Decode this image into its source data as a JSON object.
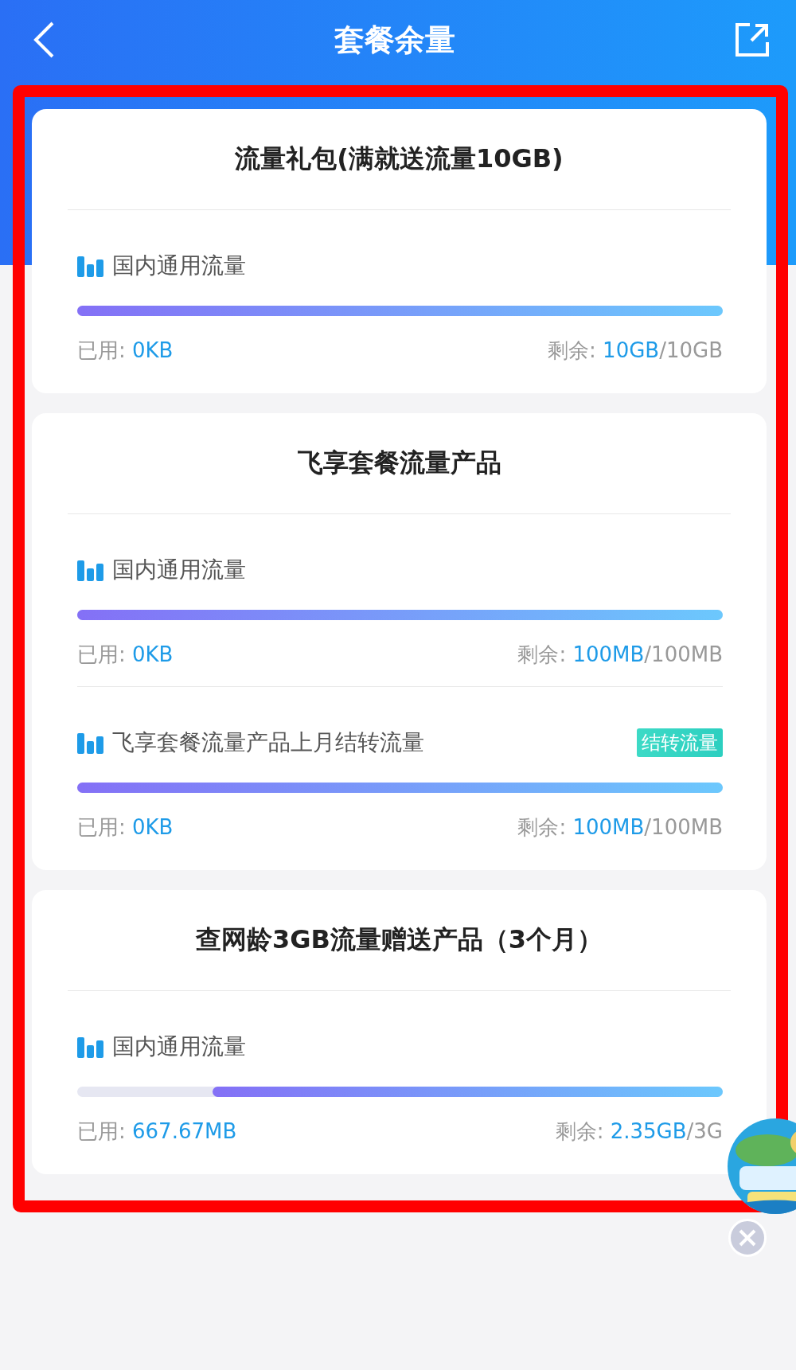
{
  "header": {
    "title": "套餐余量"
  },
  "packages": [
    {
      "title": "流量礼包(满就送流量10GB)",
      "items": [
        {
          "name": "国内通用流量",
          "level": 1,
          "used_label": "已用:",
          "used": "0KB",
          "remain_label": "剩余:",
          "remain": "10GB",
          "total": "/10GB"
        }
      ]
    },
    {
      "title": "飞享套餐流量产品",
      "items": [
        {
          "name": "国内通用流量",
          "level": 1,
          "used_label": "已用:",
          "used": "0KB",
          "remain_label": "剩余:",
          "remain": "100MB",
          "total": "/100MB"
        },
        {
          "name": "飞享套餐流量产品上月结转流量",
          "tag": "结转流量",
          "level": 1,
          "used_label": "已用:",
          "used": "0KB",
          "remain_label": "剩余:",
          "remain": "100MB",
          "total": "/100MB"
        }
      ]
    },
    {
      "title": "查网龄3GB流量赠送产品（3个月）",
      "items": [
        {
          "name": "国内通用流量",
          "level": 0.79,
          "used_label": "已用:",
          "used": "667.67MB",
          "remain_label": "剩余:",
          "remain": "2.35GB",
          "total": "/3G"
        }
      ]
    }
  ]
}
